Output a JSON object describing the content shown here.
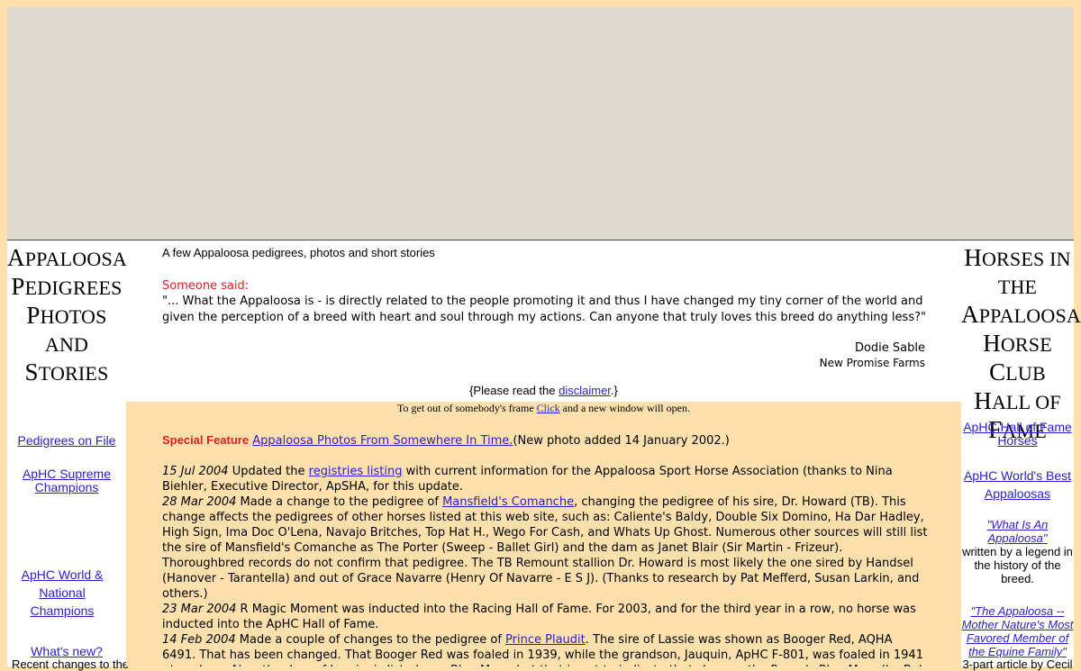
{
  "left": {
    "title_lines": [
      "Appaloosa",
      "Pedigrees",
      "Photos",
      "and Stories"
    ],
    "links": [
      {
        "label": "Pedigrees on File"
      },
      {
        "label": "ApHC Supreme Champions"
      },
      {
        "label": "ApHC World & National Champions"
      },
      {
        "label": "What's new?"
      }
    ],
    "whats_new_desc": "Recent changes to the"
  },
  "right": {
    "title_lines": [
      "Horses in the",
      "Appaloosa",
      "Horse Club",
      "Hall of",
      "Fame"
    ],
    "links": [
      {
        "label": "ApHC Hall of Fame Horses"
      },
      {
        "label": "ApHC World's Best Appaloosas"
      },
      {
        "label": "\"What Is An Appaloosa\""
      },
      {
        "label": "\"The Appaloosa -- Mother Nature's Most Favored Member of the Equine Family\""
      }
    ],
    "what_is_desc": "written by a legend in the history of the breed.",
    "mother_desc": "3-part article by Cecil"
  },
  "top": {
    "tagline": "A few Appaloosa pedigrees, photos and short stories",
    "said_label": "Someone said:",
    "quote": "\"... What the Appaloosa is - is directly related to the people promoting it and thus I have changed my tiny corner of the world and given the perception of a breed with heart and soul through my actions. Can anyone that truly loves this breed do anything less?\"",
    "author": "Dodie Sable",
    "farm": "New Promise Farms",
    "disclaimer_pre": "{Please read the ",
    "disclaimer_link": "disclaimer",
    "disclaimer_post": ".}"
  },
  "main": {
    "frame_note_pre": "To get out of somebody's frame ",
    "frame_note_link": "Click",
    "frame_note_post": " and a new window will open.",
    "feature_label": "Special Feature",
    "feature_link": "Appaloosa Photos From Somewhere In Time.",
    "feature_note": "(New photo added 14 January 2002.)",
    "entries": [
      {
        "date": "15 Jul 2004",
        "pre": " Updated the ",
        "link": "registries listing",
        "post": " with current information for the Appaloosa Sport Horse Association (thanks to Nina Biehler, Executive Director, ApSHA, for this update."
      },
      {
        "date": "28 Mar 2004",
        "pre": " Made a change to the pedigree of ",
        "link": "Mansfield's Comanche",
        "post": ", changing the pedigree of his sire, Dr. Howard (TB). This change affects the pedigrees of other horses listed at this web site, such as:   Caliente's Baldy, Double Six Domino, Ha Dar Hadley, High Sign, Ima Doc O'Lena, Navajo Britches, Top Hat H., Wego For Cash, and Whats Up Ghost. Numerous other sources will still list the sire of Mansfield's Comanche as The Porter (Sweep - Ballet Girl) and the dam as Janet Blair (Sir Martin - Frizeur). Thoroughbred records do not confirm that pedigree. The TB Remount stallion Dr. Howard is most likely the one sired by Handsel (Hanover - Tarantella) and out of Grace Navarre (Henry Of Navarre - E S J). (Thanks to research by Pat Mefferd, Susan Larkin, and others.)"
      },
      {
        "date": "23 Mar 2004",
        "pre": " R Magic Moment was inducted into the Racing Hall of Fame. For 2003, and for the third year in a row, no horse was inducted into the ApHC Hall of Fame.",
        "link": "",
        "post": ""
      },
      {
        "date": "14 Feb 2004",
        "pre": " Made a couple of changes to the pedigree of ",
        "link": "Prince Plaudit",
        "post": ". The sire of Lassie was shown as Booger Red, AQHA 6491. That has been changed. That Booger Red was foaled in 1939, while the grandson, Jauquin, ApHC F-801, was foaled in 1941 - too close. Also, the dam of Lassie, is listed as a Blue Mare, but that is not to indicate that she was the Peavy's Blue Mare (by Bob H and out of a Primero"
      }
    ]
  }
}
